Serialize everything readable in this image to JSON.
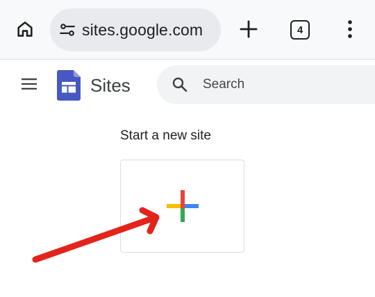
{
  "browser": {
    "url": "sites.google.com",
    "tab_count": "4"
  },
  "header": {
    "app_name": "Sites",
    "search_placeholder": "Search"
  },
  "main": {
    "section_title": "Start a new site"
  },
  "colors": {
    "annotation_arrow": "#e3241b",
    "sites_logo": "#4758c4",
    "plus_red": "#ea4335",
    "plus_blue": "#4285f4",
    "plus_green": "#34a853",
    "plus_yellow": "#fbbc04"
  }
}
